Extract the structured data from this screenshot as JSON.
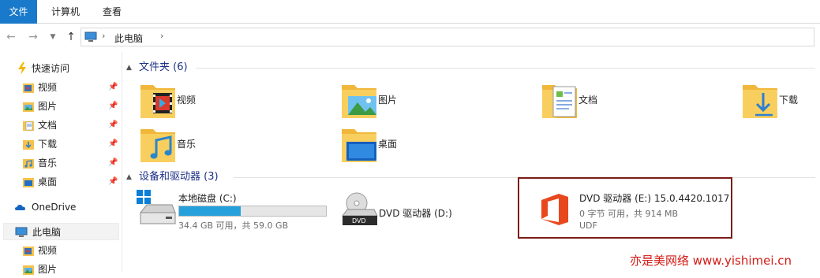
{
  "ribbon": {
    "tabs": [
      "文件",
      "计算机",
      "查看"
    ]
  },
  "address": {
    "crumb": "此电脑",
    "sep": "›"
  },
  "nav": {
    "quick_access": "快速访问",
    "items": [
      {
        "label": "视频",
        "icon": "video-folder-icon"
      },
      {
        "label": "图片",
        "icon": "pictures-folder-icon"
      },
      {
        "label": "文档",
        "icon": "documents-folder-icon"
      },
      {
        "label": "下载",
        "icon": "downloads-folder-icon"
      },
      {
        "label": "音乐",
        "icon": "music-folder-icon"
      },
      {
        "label": "桌面",
        "icon": "desktop-folder-icon"
      }
    ],
    "onedrive": "OneDrive",
    "this_pc": "此电脑",
    "pc_children": [
      {
        "label": "视频"
      },
      {
        "label": "图片"
      }
    ]
  },
  "folders_section": {
    "title": "文件夹 (6)"
  },
  "folders": [
    {
      "label": "视频"
    },
    {
      "label": "图片"
    },
    {
      "label": "文档"
    },
    {
      "label": "下载"
    },
    {
      "label": "音乐"
    },
    {
      "label": "桌面"
    }
  ],
  "drives_section": {
    "title": "设备和驱动器 (3)"
  },
  "drives": {
    "c": {
      "name": "本地磁盘 (C:)",
      "space": "34.4 GB 可用，共 59.0 GB",
      "used_fraction": 0.42
    },
    "d": {
      "name": "DVD 驱动器 (D:)",
      "badge": "DVD"
    },
    "e": {
      "name": "DVD 驱动器 (E:) 15.0.4420.1017",
      "space": "0 字节 可用，共 914 MB",
      "fs": "UDF"
    }
  },
  "watermark": "亦是美网络 www.yishimei.cn",
  "colors": {
    "accent": "#1979ca",
    "section": "#1e3287",
    "highlight": "#7b1c18",
    "office": "#e8481d",
    "watermark": "#d31a14"
  }
}
